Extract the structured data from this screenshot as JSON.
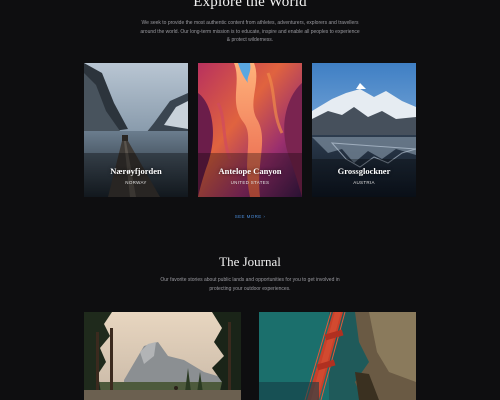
{
  "explore": {
    "title": "Explore the World",
    "intro": "We seek to provide the most authentic content from athletes, adventurers, explorers and travellers around the world. Our long-term mission is to educate, inspire and enable all peoples to experience & protect wilderness.",
    "cards": [
      {
        "name": "Nærøyfjorden",
        "country": "NORWAY"
      },
      {
        "name": "Antelope Canyon",
        "country": "UNITED STATES"
      },
      {
        "name": "Grossglockner",
        "country": "AUSTRIA"
      }
    ],
    "see_more": "SEE MORE ›"
  },
  "journal": {
    "title": "The Journal",
    "intro": "Our favorite stories about public lands and opportunities for you to get involved in protecting your outdoor experiences."
  }
}
